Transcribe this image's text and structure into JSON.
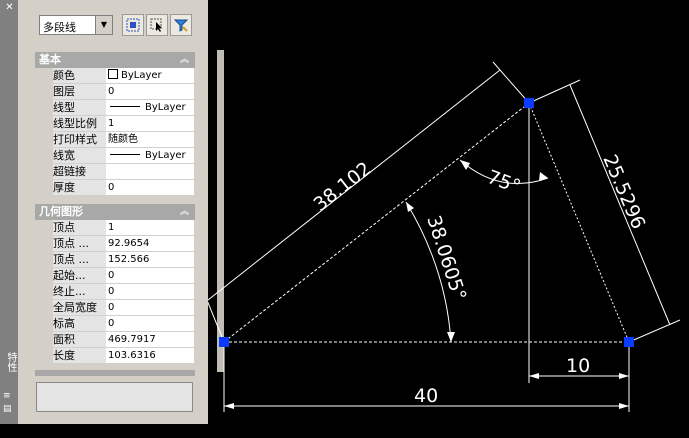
{
  "palette": {
    "title_vertical": "特性",
    "object_type": "多段线",
    "groups": [
      {
        "title": "基本",
        "rows": [
          {
            "label": "颜色",
            "value": "ByLayer",
            "swatch": true,
            "line": false
          },
          {
            "label": "图层",
            "value": "0",
            "swatch": false,
            "line": false
          },
          {
            "label": "线型",
            "value": "ByLayer",
            "swatch": false,
            "line": true
          },
          {
            "label": "线型比例",
            "value": "1",
            "swatch": false,
            "line": false
          },
          {
            "label": "打印样式",
            "value": "随颜色",
            "swatch": false,
            "line": false
          },
          {
            "label": "线宽",
            "value": "ByLayer",
            "swatch": false,
            "line": true
          },
          {
            "label": "超链接",
            "value": "",
            "swatch": false,
            "line": false
          },
          {
            "label": "厚度",
            "value": "0",
            "swatch": false,
            "line": false
          }
        ]
      },
      {
        "title": "几何图形",
        "rows": [
          {
            "label": "顶点",
            "value": "1",
            "swatch": false,
            "line": false
          },
          {
            "label": "顶点 ...",
            "value": "92.9654",
            "swatch": false,
            "line": false
          },
          {
            "label": "顶点 ...",
            "value": "152.566",
            "swatch": false,
            "line": false
          },
          {
            "label": "起始...",
            "value": "0",
            "swatch": false,
            "line": false
          },
          {
            "label": "终止...",
            "value": "0",
            "swatch": false,
            "line": false
          },
          {
            "label": "全局宽度",
            "value": "0",
            "swatch": false,
            "line": false
          },
          {
            "label": "标高",
            "value": "0",
            "swatch": false,
            "line": false
          },
          {
            "label": "面积",
            "value": "469.7917",
            "swatch": false,
            "line": false
          },
          {
            "label": "长度",
            "value": "103.6316",
            "swatch": false,
            "line": false
          }
        ]
      }
    ]
  },
  "drawing": {
    "dim_left_side": "38.102",
    "dim_right_side": "25.5296",
    "dim_angle_top": "75°",
    "dim_angle_left": "38.0605°",
    "dim_offset": "10",
    "dim_base": "40",
    "line_color": "#ffffff",
    "grip_color": "#0a3cff"
  }
}
